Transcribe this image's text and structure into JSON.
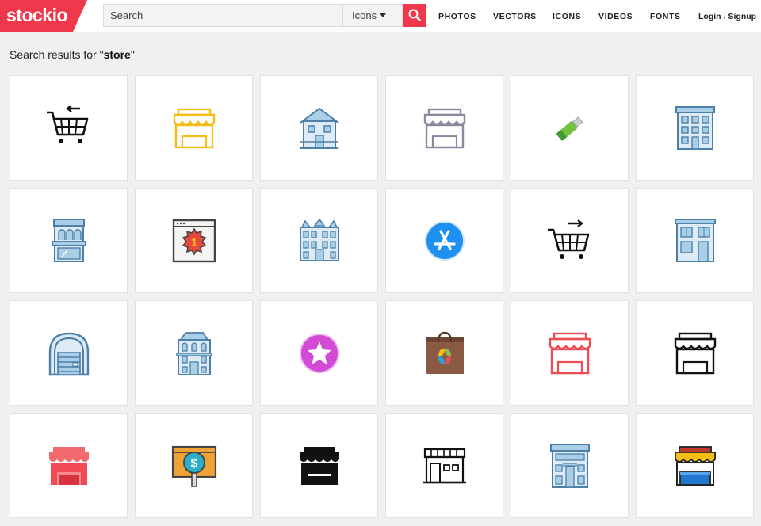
{
  "header": {
    "logo": "stockio",
    "search": {
      "placeholder": "Search",
      "value": ""
    },
    "type_selector": {
      "selected": "Icons"
    },
    "search_button": "search-icon",
    "nav": [
      "PHOTOS",
      "VECTORS",
      "ICONS",
      "VIDEOS",
      "FONTS"
    ],
    "login": "Login",
    "login_sep": "/",
    "signup": "Signup"
  },
  "results": {
    "prefix": "Search results for \"",
    "query": "store",
    "suffix": "\""
  },
  "colors": {
    "brand": "#f0384c",
    "outline_blue": "#4d7fa8",
    "fill_blue": "#a9cfe6",
    "yellow": "#f6bd16",
    "purple_gray": "#8f86a1",
    "red": "#f04a55"
  },
  "icons": [
    "cart-return-icon",
    "awning-store-yellow-icon",
    "house-icon",
    "awning-store-purple-icon",
    "usb-drive-icon",
    "apartment-building-icon",
    "shop-front-blue-icon",
    "number-one-badge-icon",
    "mansion-icon",
    "app-store-icon",
    "cart-forward-icon",
    "store-building-icon",
    "warehouse-icon",
    "townhouse-icon",
    "star-badge-icon",
    "shopping-bag-icon",
    "awning-store-red-icon",
    "awning-store-black-icon",
    "filled-store-red-icon",
    "dollar-search-icon",
    "filled-store-black-icon",
    "shop-outline-icon",
    "shop-building-blue-icon",
    "awning-store-color-icon"
  ]
}
